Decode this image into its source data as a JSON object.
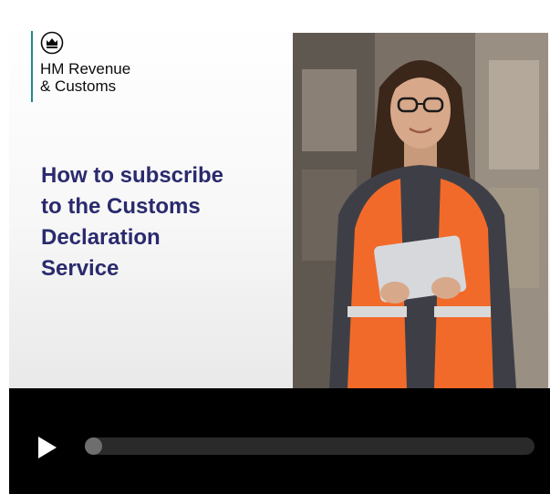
{
  "logo": {
    "icon": "crown-crest-icon",
    "line1": "HM Revenue",
    "line2": "& Customs",
    "accent_color": "#1d8a8a"
  },
  "slide": {
    "title_lines": [
      "How to subscribe",
      "to the Customs",
      "Declaration",
      "Service"
    ],
    "title_color": "#2a2a6e"
  },
  "player": {
    "play_icon": "play-icon",
    "progress": 0.0
  }
}
